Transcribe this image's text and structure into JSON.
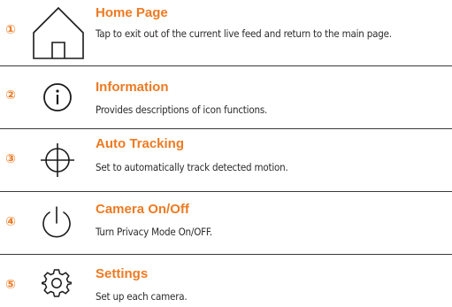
{
  "items": [
    {
      "number": "①",
      "icon": "home-icon",
      "title": "Home Page",
      "description": "Tap to exit out of the current live feed and return to the main page."
    },
    {
      "number": "②",
      "icon": "info-icon",
      "title": "Information",
      "description": "Provides descriptions of icon functions."
    },
    {
      "number": "③",
      "icon": "crosshair-icon",
      "title": "Auto Tracking",
      "description": "Set to automatically track detected motion."
    },
    {
      "number": "④",
      "icon": "power-icon",
      "title": "Camera On/Off",
      "description": "Turn Privacy Mode On/OFF."
    },
    {
      "number": "⑤",
      "icon": "gear-icon",
      "title": "Settings",
      "description": "Set up each camera."
    }
  ],
  "colors": {
    "accent": "#ee7a22",
    "text": "#2b2b2b",
    "divider": "#3a3a3a"
  }
}
